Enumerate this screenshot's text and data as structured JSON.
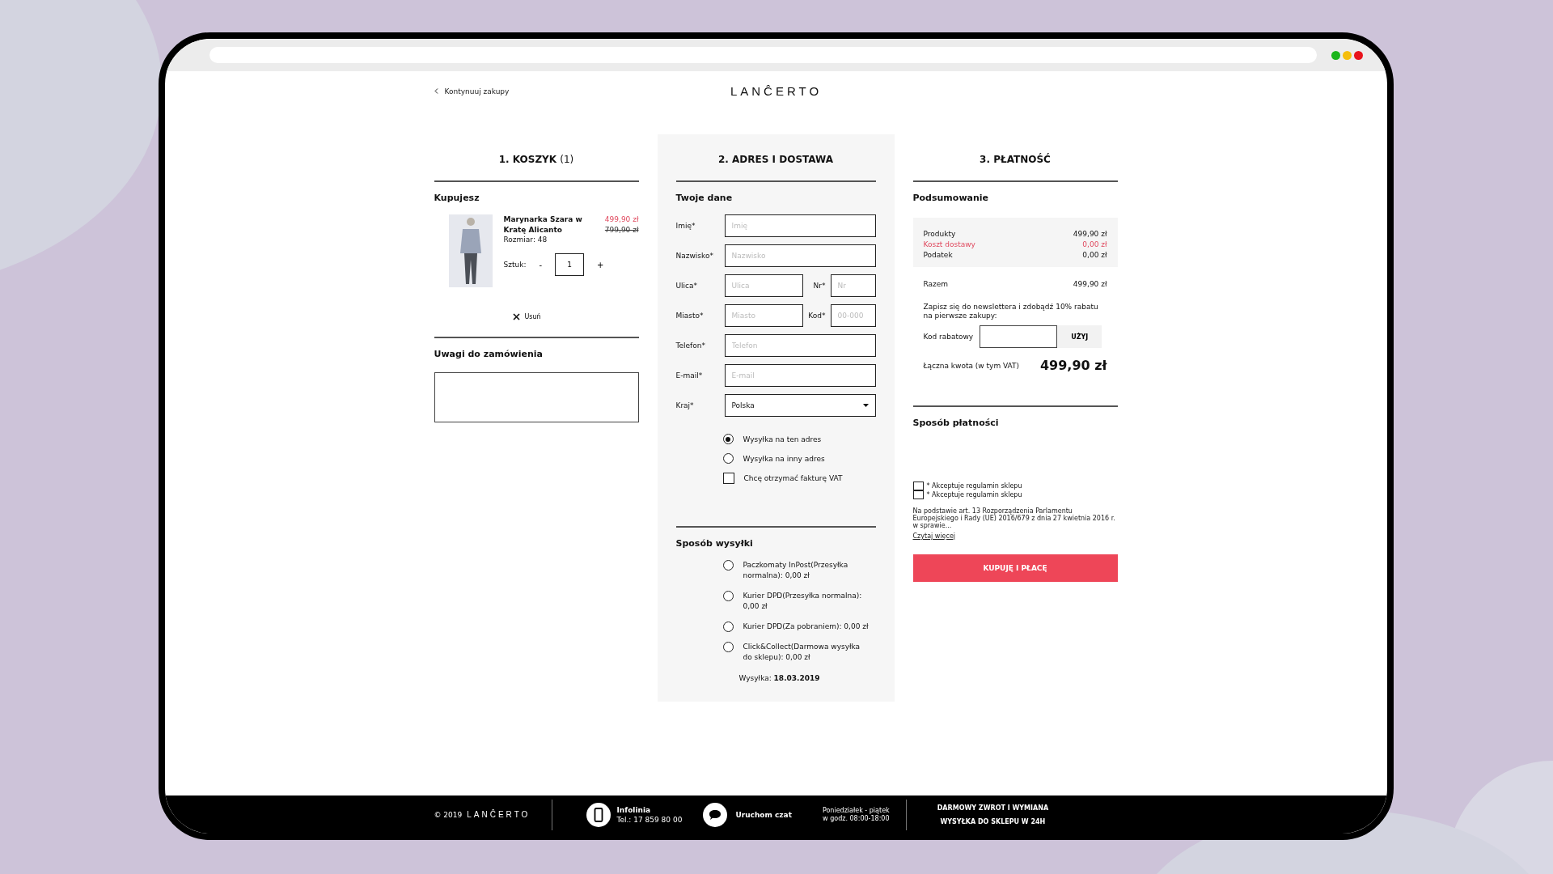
{
  "window": {
    "controls": [
      {
        "color": "#1cb51c"
      },
      {
        "color": "#f5be0b"
      },
      {
        "color": "#e8141c"
      }
    ]
  },
  "header": {
    "back_link": "Kontynuuj zakupy",
    "logo": "LANĈERTO"
  },
  "cart": {
    "title": "1. KOSZYK",
    "count": "(1)",
    "section": "Kupujesz",
    "product": {
      "name": "Marynarka Szara w Kratę Alicanto",
      "price": "499,90 zł",
      "old_price": "799,90 zł",
      "size": "Rozmiar: 48",
      "qty_label": "Sztuk:",
      "minus": "-",
      "qty": "1",
      "plus": "+",
      "remove": "Usuń"
    },
    "notes_title": "Uwagi do zamówienia"
  },
  "address": {
    "title": "2. ADRES I DOSTAWA",
    "section": "Twoje dane",
    "rows": [
      [
        {
          "kind": "text",
          "label": "Imię*",
          "placeholder": "Imię"
        }
      ],
      [
        {
          "kind": "text",
          "label": "Nazwisko*",
          "placeholder": "Nazwisko"
        }
      ],
      [
        {
          "kind": "text",
          "label": "Ulica*",
          "placeholder": "Ulica"
        },
        {
          "kind": "text",
          "label": "Nr*",
          "placeholder": "Nr"
        }
      ],
      [
        {
          "kind": "text",
          "label": "Miasto*",
          "placeholder": "Miasto"
        },
        {
          "kind": "text",
          "label": "Kod*",
          "placeholder": "00-000"
        }
      ],
      [
        {
          "kind": "text",
          "label": "Telefon*",
          "placeholder": "Telefon"
        }
      ],
      [
        {
          "kind": "text",
          "label": "E-mail*",
          "placeholder": "E-mail"
        }
      ],
      [
        {
          "kind": "select",
          "label": "Kraj*",
          "value": "Polska"
        }
      ]
    ],
    "options": [
      {
        "kind": "radio",
        "label": "Wysyłka na ten adres",
        "checked": true
      },
      {
        "kind": "radio",
        "label": "Wysyłka na inny adres",
        "checked": false
      },
      {
        "kind": "checkbox",
        "label": "Chcę otrzymać fakturę VAT",
        "checked": false
      }
    ]
  },
  "shipping": {
    "title": "Sposób wysyłki",
    "options": [
      {
        "label": "Paczkomaty InPost(Przesyłka normalna): 0,00 zł",
        "selected": false
      },
      {
        "label": "Kurier DPD(Przesyłka normalna): 0,00 zł",
        "selected": false
      },
      {
        "label": "Kurier DPD(Za pobraniem): 0,00 zł",
        "selected": false
      },
      {
        "label": "Click&Collect(Darmowa wysyłka do sklepu): 0,00 zł",
        "selected": false
      }
    ],
    "date": "Wysyłka: **18.03.2019**"
  },
  "payment": {
    "title": "3. PŁATNOŚĆ",
    "section": "Podsumowanie",
    "summary": [
      {
        "label": "Produkty",
        "value": "499,90 zł",
        "highlight": false
      },
      {
        "label": "Koszt dostawy",
        "value": "0,00 zł",
        "highlight": true
      },
      {
        "label": "Podatek",
        "value": "0,00 zł",
        "highlight": false
      }
    ],
    "subtotal": {
      "label": "Razem",
      "value": "499,90 zł"
    },
    "newsletter": "Zapisz się do newslettera i zdobądź 10% rabatu na pierwsze zakupy:",
    "discount_label": "Kod rabatowy",
    "discount_button": "UŻYJ",
    "total_label": "Łączna kwota (w tym VAT)",
    "total": "499,90 zł",
    "method_title": "Sposób płatności",
    "terms": [
      {
        "label": "* Akceptuje regulamin sklepu",
        "checked": false
      },
      {
        "label": "* Akceptuje regulamin sklepu",
        "checked": false
      }
    ],
    "gdpr": "Na podstawie art. 13 Rozporządzenia Parlamentu Europejskiego i Rady (UE) 2016/679 z dnia 27 kwietnia 2016 r. w sprawie...",
    "read_more": "Czytaj więcej",
    "submit": "KUPUJĘ I PŁACĘ"
  },
  "footer": {
    "copyright": "© 2019",
    "logo": "LANĈERTO",
    "hotline_title": "Infolinia",
    "hotline_phone": "Tel.: 17 859 80 00",
    "chat": "Uruchom czat",
    "hours": [
      "Poniedziałek - piątek",
      "w godz. 08:00-18:00"
    ],
    "benefits": [
      "DARMOWY ZWROT I WYMIANA",
      "WYSYŁKA DO SKLEPU W 24H"
    ]
  }
}
